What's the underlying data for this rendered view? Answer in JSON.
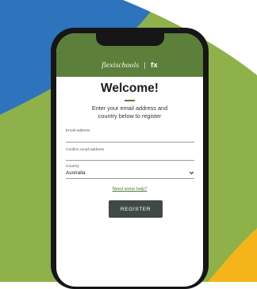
{
  "colors": {
    "brand_green": "#5c7f3a",
    "page_green": "#8fb14a",
    "blue": "#2d74bc",
    "yellow": "#f3b51a",
    "button": "#3f4a45",
    "link": "#4f7a2d"
  },
  "header": {
    "brand": "flexischools",
    "divider": "|",
    "partner_mark": "fx"
  },
  "form": {
    "title": "Welcome!",
    "subtitle_line1": "Enter your email address and",
    "subtitle_line2": "country below to register",
    "email_label": "Email address",
    "confirm_email_label": "Confirm email address",
    "country_label": "Country",
    "country_value": "Australia",
    "help_link": "Need some help?",
    "register_button": "REGISTER"
  },
  "icons": {
    "country_dropdown": "chevron-down-icon"
  }
}
